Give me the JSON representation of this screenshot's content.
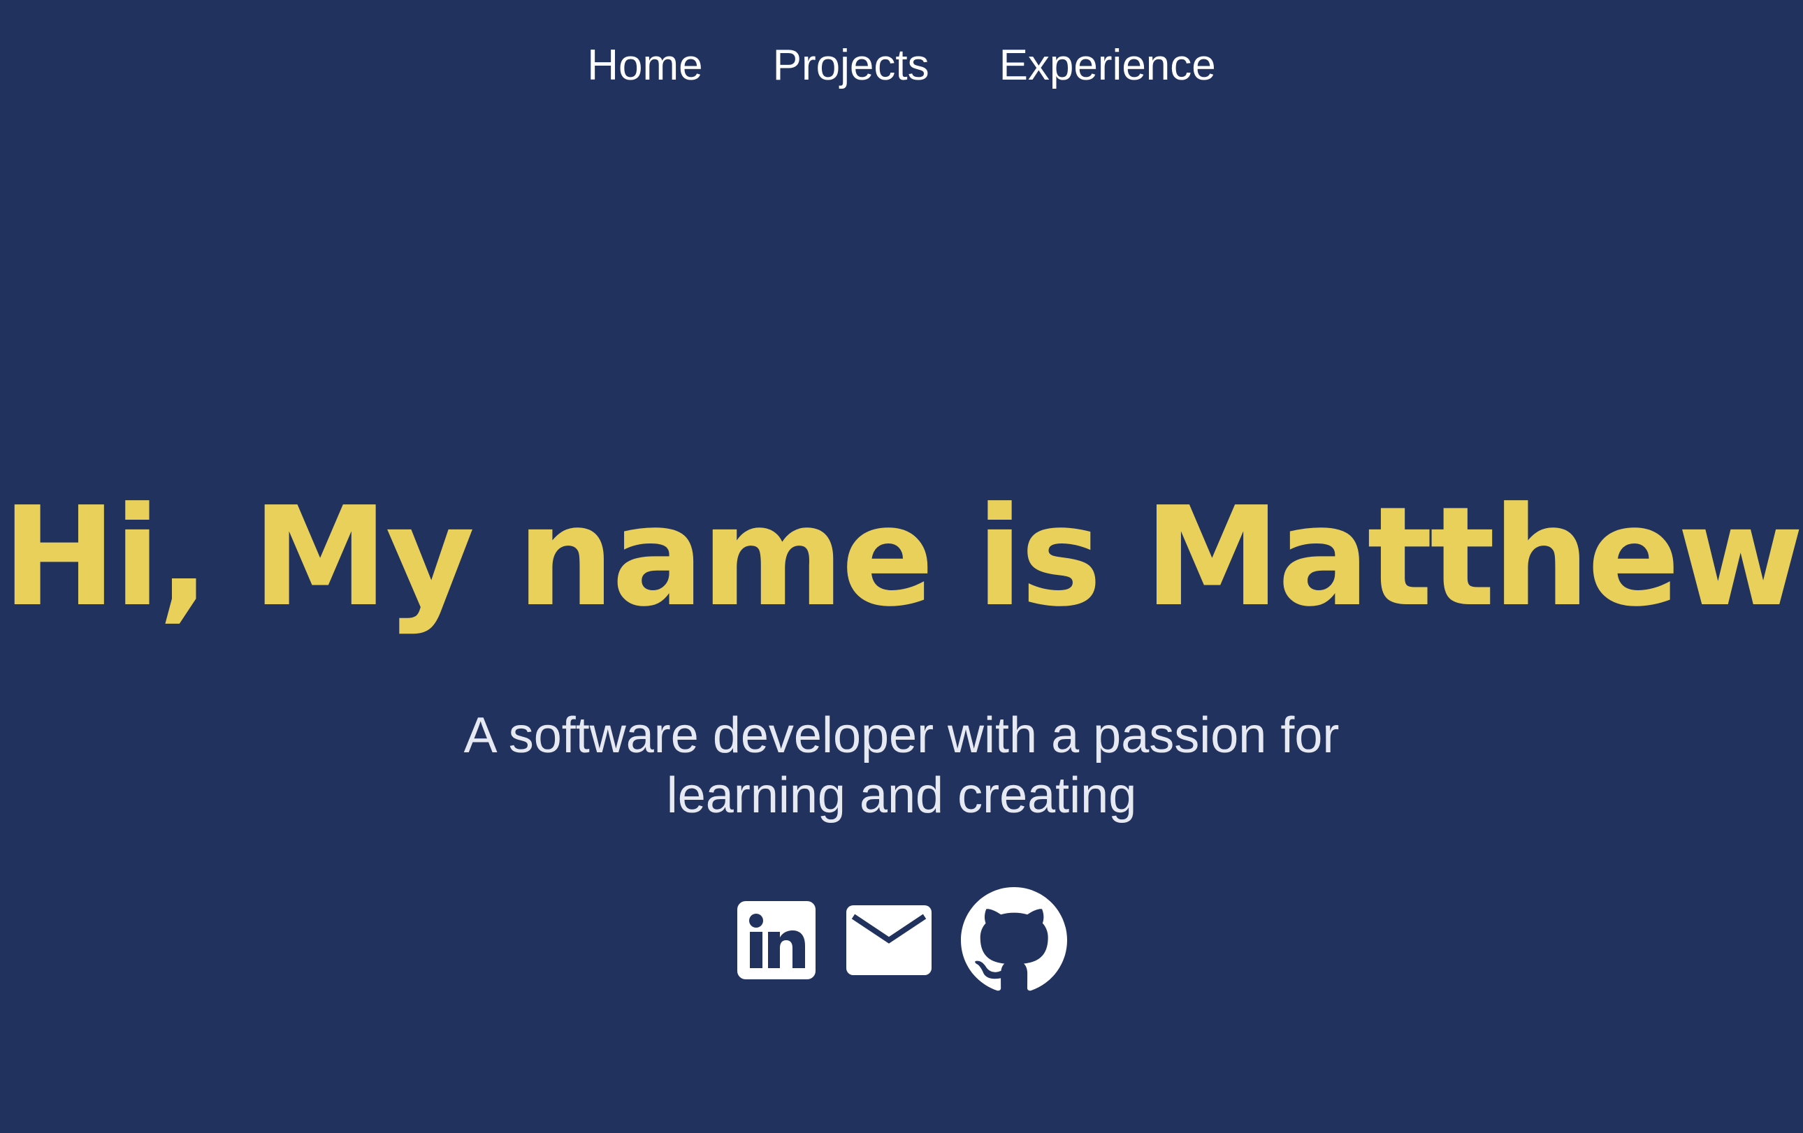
{
  "nav": {
    "items": [
      {
        "label": "Home"
      },
      {
        "label": "Projects"
      },
      {
        "label": "Experience"
      }
    ]
  },
  "hero": {
    "title": "Hi, My name is Matthew",
    "subtitle": "A software developer with a passion for learning and creating"
  },
  "socials": [
    {
      "icon": "linkedin-icon"
    },
    {
      "icon": "mail-icon"
    },
    {
      "icon": "github-icon"
    }
  ],
  "colors": {
    "background": "#22325e",
    "accent": "#e8d05a",
    "text": "#ffffff"
  }
}
